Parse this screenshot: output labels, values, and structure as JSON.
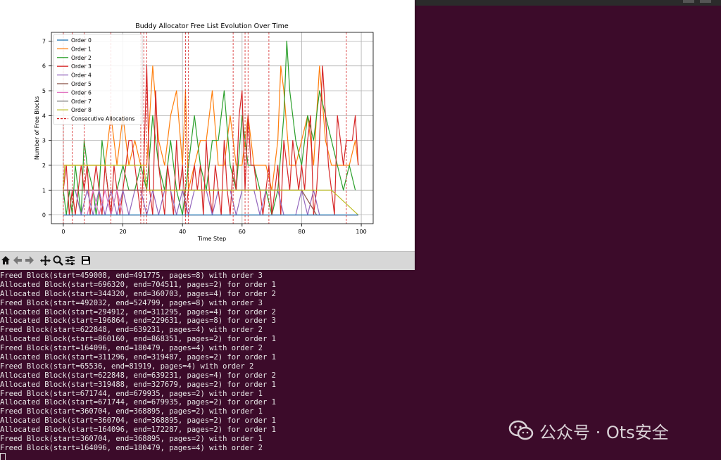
{
  "chart_data": {
    "type": "line",
    "title": "Buddy Allocator Free List Evolution Over Time",
    "xlabel": "Time Step",
    "ylabel": "Number of Free Blocks",
    "xlim": [
      -4,
      104
    ],
    "ylim": [
      -0.35,
      7.35
    ],
    "xticks": [
      "0",
      "20",
      "40",
      "60",
      "80",
      "100"
    ],
    "xtick_values": [
      0,
      20,
      40,
      60,
      80,
      100
    ],
    "yticks": [
      "0",
      "1",
      "2",
      "3",
      "4",
      "5",
      "6",
      "7"
    ],
    "ytick_values": [
      0,
      1,
      2,
      3,
      4,
      5,
      6,
      7
    ],
    "grid": true,
    "legend_position": "top-left",
    "legend": [
      {
        "name": "Order 0",
        "color": "#1f77b4"
      },
      {
        "name": "Order 1",
        "color": "#ff7f0e"
      },
      {
        "name": "Order 2",
        "color": "#2ca02c"
      },
      {
        "name": "Order 3",
        "color": "#d62728"
      },
      {
        "name": "Order 4",
        "color": "#9467bd"
      },
      {
        "name": "Order 5",
        "color": "#8c564b"
      },
      {
        "name": "Order 6",
        "color": "#e377c2"
      },
      {
        "name": "Order 7",
        "color": "#7f7f7f"
      },
      {
        "name": "Order 8",
        "color": "#bcbd22"
      },
      {
        "name": "Consecutive Allocations",
        "color": "#d62728",
        "style": "dashed"
      }
    ],
    "consecutive_allocations_x": [
      0,
      3,
      7,
      16,
      26,
      27,
      28,
      41,
      42,
      57,
      61,
      62,
      69,
      95
    ],
    "series": [
      {
        "name": "Order 1",
        "color": "#ff7f0e",
        "x": [
          0,
          2,
          4,
          6,
          8,
          10,
          12,
          14,
          15,
          16,
          17,
          18,
          20,
          22,
          24,
          26,
          28,
          30,
          32,
          34,
          36,
          38,
          40,
          41,
          42,
          44,
          46,
          48,
          50,
          52,
          54,
          56,
          58,
          60,
          62,
          64,
          66,
          68,
          70,
          72,
          73,
          74,
          76,
          78,
          80,
          82,
          84,
          86,
          88,
          90,
          92,
          94,
          96,
          98,
          99
        ],
        "y": [
          2,
          2,
          2,
          2,
          2,
          2,
          2,
          2,
          3,
          4,
          3,
          2,
          4,
          2,
          3,
          2,
          2,
          6,
          3,
          2,
          4,
          5,
          2,
          5,
          1,
          2,
          3,
          3,
          5,
          2,
          2,
          4,
          2,
          2,
          4,
          2,
          2,
          2,
          1,
          3,
          6,
          5,
          2,
          2,
          3,
          4,
          2,
          6,
          3,
          2,
          2,
          2,
          2,
          3,
          2
        ]
      },
      {
        "name": "Order 2",
        "color": "#2ca02c",
        "x": [
          0,
          1,
          2,
          3,
          4,
          5,
          6,
          7,
          8,
          10,
          11,
          12,
          13,
          14,
          15,
          16,
          18,
          20,
          22,
          24,
          26,
          28,
          30,
          32,
          34,
          36,
          38,
          40,
          42,
          44,
          46,
          48,
          50,
          52,
          54,
          56,
          58,
          60,
          62,
          64,
          66,
          68,
          70,
          72,
          74,
          75,
          76,
          78,
          80,
          82,
          84,
          86,
          88,
          90,
          92,
          94,
          96,
          98
        ],
        "y": [
          1,
          0,
          1,
          0,
          2,
          1,
          0,
          3,
          2,
          1,
          0,
          1,
          3,
          2,
          1,
          0,
          1,
          2,
          1,
          1,
          2,
          1,
          4,
          2,
          1,
          3,
          1,
          0,
          2,
          4,
          2,
          1,
          3,
          3,
          5,
          2,
          1,
          4,
          2,
          2,
          1,
          1,
          0,
          1,
          4,
          7,
          5,
          3,
          2,
          4,
          3,
          5,
          4,
          3,
          2,
          1,
          2,
          1
        ]
      },
      {
        "name": "Order 3",
        "color": "#d62728",
        "x": [
          0,
          1,
          2,
          3,
          4,
          5,
          6,
          7,
          8,
          9,
          10,
          11,
          12,
          13,
          14,
          15,
          16,
          17,
          18,
          19,
          20,
          21,
          22,
          23,
          24,
          25,
          26,
          27,
          28,
          29,
          30,
          31,
          32,
          33,
          34,
          35,
          36,
          37,
          38,
          39,
          40,
          41,
          42,
          43,
          44,
          45,
          46,
          47,
          48,
          49,
          50,
          51,
          52,
          53,
          54,
          55,
          56,
          57,
          58,
          59,
          60,
          61,
          62,
          63,
          64,
          65,
          66,
          67,
          68,
          69,
          70,
          71,
          72,
          73,
          74,
          75,
          76,
          77,
          78,
          79,
          80,
          81,
          82,
          83,
          84,
          85,
          86,
          87,
          88,
          89,
          90,
          91,
          92,
          93,
          94,
          95,
          96,
          97,
          98,
          99
        ],
        "y": [
          1,
          2,
          0,
          1,
          0,
          1,
          2,
          1,
          2,
          0,
          1,
          2,
          1,
          0,
          2,
          1,
          0,
          2,
          1,
          0,
          1,
          2,
          3,
          3,
          2,
          1,
          0,
          2,
          6,
          1,
          0,
          5,
          2,
          1,
          0,
          2,
          1,
          0,
          3,
          1,
          2,
          0,
          1,
          1,
          2,
          1,
          2,
          0,
          3,
          1,
          0,
          2,
          1,
          0,
          3,
          1,
          0,
          2,
          1,
          4,
          5,
          1,
          4,
          2,
          2,
          1,
          1,
          0,
          1,
          2,
          0,
          1,
          2,
          0,
          3,
          2,
          1,
          3,
          2,
          1,
          2,
          1,
          3,
          4,
          0,
          1,
          3,
          6,
          4,
          2,
          1,
          0,
          4,
          3,
          2,
          3,
          3,
          3,
          4,
          2
        ]
      },
      {
        "name": "Order 4",
        "color": "#9467bd",
        "x": [
          0,
          4,
          6,
          8,
          10,
          12,
          14,
          16,
          18,
          20,
          22,
          24,
          26,
          28,
          30,
          32,
          34,
          36,
          38,
          40,
          42,
          44,
          46,
          48,
          50,
          52,
          54,
          56,
          58,
          60,
          62,
          64,
          66,
          68,
          70,
          72,
          74,
          76,
          78,
          80,
          82,
          84,
          86,
          88,
          90,
          92,
          94,
          96,
          98,
          99
        ],
        "y": [
          1,
          1,
          0,
          1,
          0,
          1,
          0,
          1,
          0,
          1,
          0,
          1,
          1,
          0,
          1,
          0,
          1,
          1,
          0,
          1,
          0,
          1,
          1,
          1,
          0,
          1,
          1,
          1,
          0,
          1,
          1,
          1,
          0,
          1,
          1,
          1,
          0,
          0,
          0,
          1,
          0,
          1,
          0,
          0,
          0,
          0,
          0,
          0,
          0,
          0
        ]
      },
      {
        "name": "Order 5",
        "color": "#8c564b",
        "x": [
          0,
          5,
          10,
          15,
          20,
          25,
          30,
          35,
          40,
          45,
          50,
          55,
          60,
          65,
          70,
          75,
          80,
          85,
          90,
          95,
          99
        ],
        "y": [
          1,
          1,
          1,
          1,
          1,
          1,
          1,
          1,
          1,
          1,
          1,
          1,
          1,
          1,
          1,
          1,
          1,
          0,
          0,
          0,
          0
        ]
      },
      {
        "name": "Order 6",
        "color": "#e377c2",
        "x": [
          0,
          8,
          10,
          12,
          14,
          16,
          18,
          20,
          22,
          24,
          26,
          28,
          30,
          40,
          50,
          60,
          70,
          80,
          90,
          99
        ],
        "y": [
          0,
          0,
          1,
          0,
          1,
          0,
          1,
          0,
          0,
          0,
          0,
          0,
          0,
          0,
          0,
          0,
          0,
          0,
          0,
          0
        ]
      },
      {
        "name": "Order 7",
        "color": "#7f7f7f",
        "x": [
          0,
          50,
          99
        ],
        "y": [
          0,
          0,
          0
        ]
      },
      {
        "name": "Order 8",
        "color": "#bcbd22",
        "x": [
          0,
          0.5,
          27,
          28,
          40,
          50,
          60,
          70,
          80,
          90,
          99
        ],
        "y": [
          1,
          2,
          2,
          1,
          1,
          1,
          1,
          1,
          1,
          1,
          0
        ]
      },
      {
        "name": "Order 0",
        "color": "#1f77b4",
        "x": [
          0,
          50,
          99
        ],
        "y": [
          0,
          0,
          0
        ]
      }
    ]
  },
  "terminal": {
    "lines": [
      "Freed Block(start=459008, end=491775, pages=8) with order 3",
      "Allocated Block(start=696320, end=704511, pages=2) for order 1",
      "Allocated Block(start=344320, end=360703, pages=4) for order 2",
      "Freed Block(start=492032, end=524799, pages=8) with order 3",
      "Allocated Block(start=294912, end=311295, pages=4) for order 2",
      "Allocated Block(start=196864, end=229631, pages=8) for order 3",
      "Freed Block(start=622848, end=639231, pages=4) with order 2",
      "Allocated Block(start=860160, end=868351, pages=2) for order 1",
      "Freed Block(start=164096, end=180479, pages=4) with order 2",
      "Allocated Block(start=311296, end=319487, pages=2) for order 1",
      "Freed Block(start=65536, end=81919, pages=4) with order 2",
      "Allocated Block(start=622848, end=639231, pages=4) for order 2",
      "Allocated Block(start=319488, end=327679, pages=2) for order 1",
      "Freed Block(start=671744, end=679935, pages=2) with order 1",
      "Allocated Block(start=671744, end=679935, pages=2) for order 1",
      "Freed Block(start=360704, end=368895, pages=2) with order 1",
      "Allocated Block(start=360704, end=368895, pages=2) for order 1",
      "Allocated Block(start=164096, end=172287, pages=2) for order 1",
      "Freed Block(start=360704, end=368895, pages=2) with order 1",
      "Freed Block(start=164096, end=180479, pages=4) with order 2"
    ]
  },
  "toolbar": {
    "icons": [
      "home-icon",
      "back-arrow-icon",
      "forward-arrow-icon",
      "pan-icon",
      "zoom-icon",
      "configure-subplots-icon",
      "save-icon"
    ]
  },
  "watermark": {
    "text": "公众号 · Ots安全"
  }
}
